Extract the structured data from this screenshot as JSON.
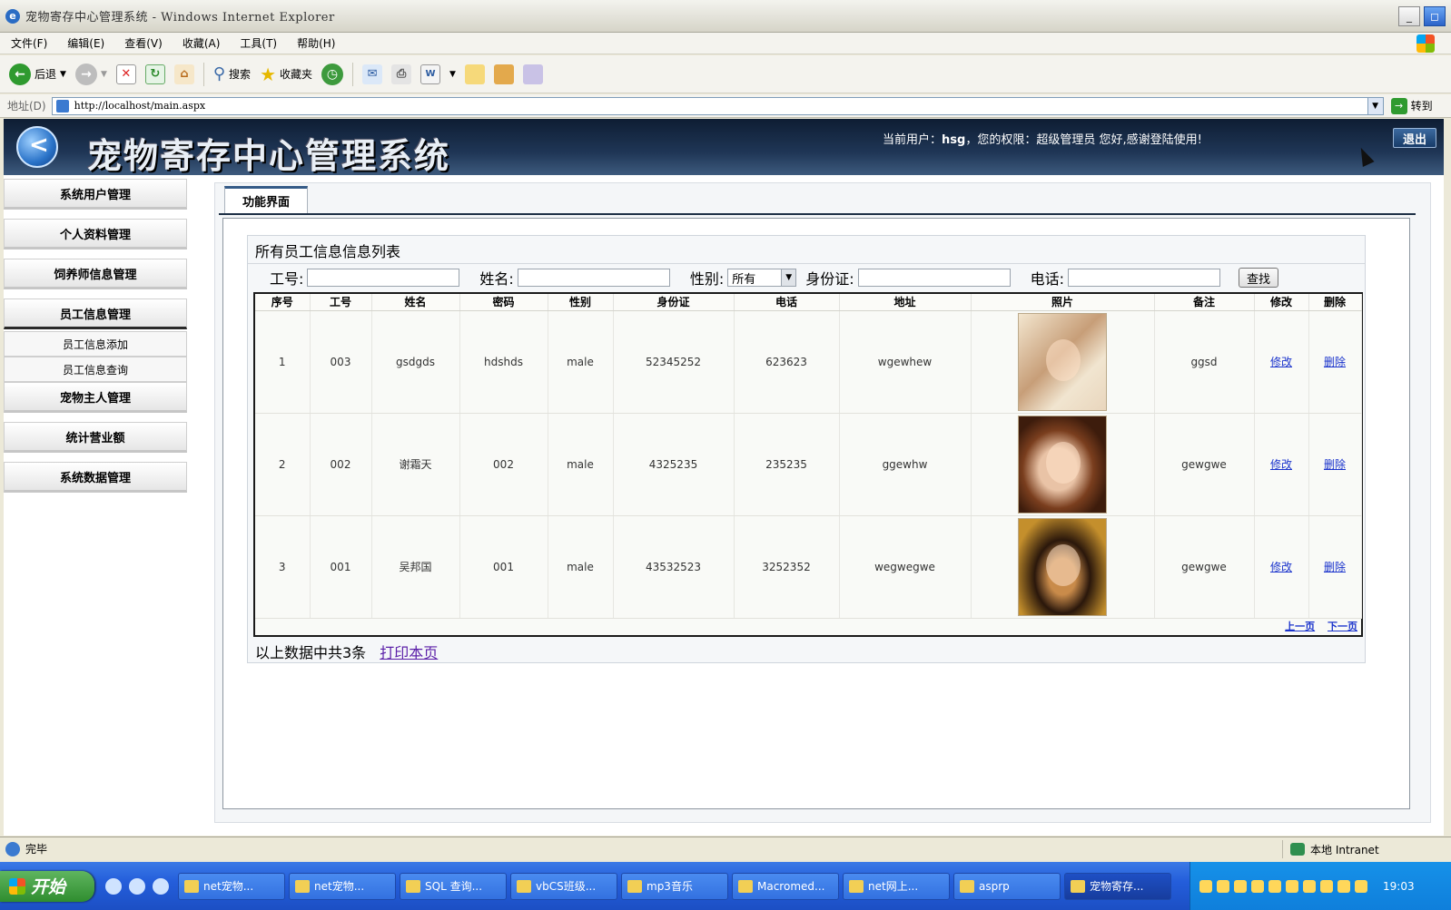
{
  "window": {
    "title": "宠物寄存中心管理系统 - Windows Internet Explorer"
  },
  "menu": [
    "文件(F)",
    "编辑(E)",
    "查看(V)",
    "收藏(A)",
    "工具(T)",
    "帮助(H)"
  ],
  "toolbar": {
    "back_label": "后退",
    "search_label": "搜索",
    "favorites_label": "收藏夹"
  },
  "address": {
    "label": "地址(D)",
    "url": "http://localhost/main.aspx",
    "go_label": "转到"
  },
  "header": {
    "system_title": "宠物寄存中心管理系统",
    "user_prefix": "当前用户：",
    "user_name": "hsg",
    "user_suffix": "，您的权限：超级管理员  您好,感谢登陆使用!",
    "logout_label": "退出"
  },
  "sidebar": {
    "items": [
      {
        "label": "系统用户管理"
      },
      {
        "label": "个人资料管理"
      },
      {
        "label": "饲养师信息管理"
      },
      {
        "label": "员工信息管理"
      },
      {
        "label": "宠物主人管理"
      },
      {
        "label": "统计营业额"
      },
      {
        "label": "系统数据管理"
      }
    ],
    "sub_items": [
      "员工信息添加",
      "员工信息查询"
    ]
  },
  "main": {
    "tab_label": "功能界面",
    "list_title": "所有员工信息信息列表",
    "search": {
      "id_label": "工号:",
      "name_label": "姓名:",
      "gender_label": "性别:",
      "gender_value": "所有",
      "idcard_label": "身份证:",
      "phone_label": "电话:",
      "find_label": "查找"
    },
    "columns": [
      "序号",
      "工号",
      "姓名",
      "密码",
      "性别",
      "身份证",
      "电话",
      "地址",
      "照片",
      "备注",
      "修改",
      "删除"
    ],
    "rows": [
      {
        "no": "1",
        "id": "003",
        "name": "gsdgds",
        "password": "hdshds",
        "gender": "male",
        "idcard": "52345252",
        "phone": "623623",
        "address": "wgewhew",
        "note": "ggsd",
        "edit": "修改",
        "delete": "删除"
      },
      {
        "no": "2",
        "id": "002",
        "name": "谢霜天",
        "password": "002",
        "gender": "male",
        "idcard": "4325235",
        "phone": "235235",
        "address": "ggewhw",
        "note": "gewgwe",
        "edit": "修改",
        "delete": "删除"
      },
      {
        "no": "3",
        "id": "001",
        "name": "吴邦国",
        "password": "001",
        "gender": "male",
        "idcard": "43532523",
        "phone": "3252352",
        "address": "wegwegwe",
        "note": "gewgwe",
        "edit": "修改",
        "delete": "删除"
      }
    ],
    "pager": {
      "prev": "上一页",
      "next": "下一页"
    },
    "summary": "以上数据中共3条",
    "print_label": "打印本页"
  },
  "status": {
    "text": "完毕",
    "zone": "本地 Intranet"
  },
  "taskbar": {
    "start_label": "开始",
    "tasks": [
      "net宠物...",
      "net宠物...",
      "SQL 查询...",
      "vbCS班级...",
      "mp3音乐",
      "Macromed...",
      "net网上...",
      "asprp",
      "宠物寄存..."
    ],
    "clock": "19:03"
  }
}
